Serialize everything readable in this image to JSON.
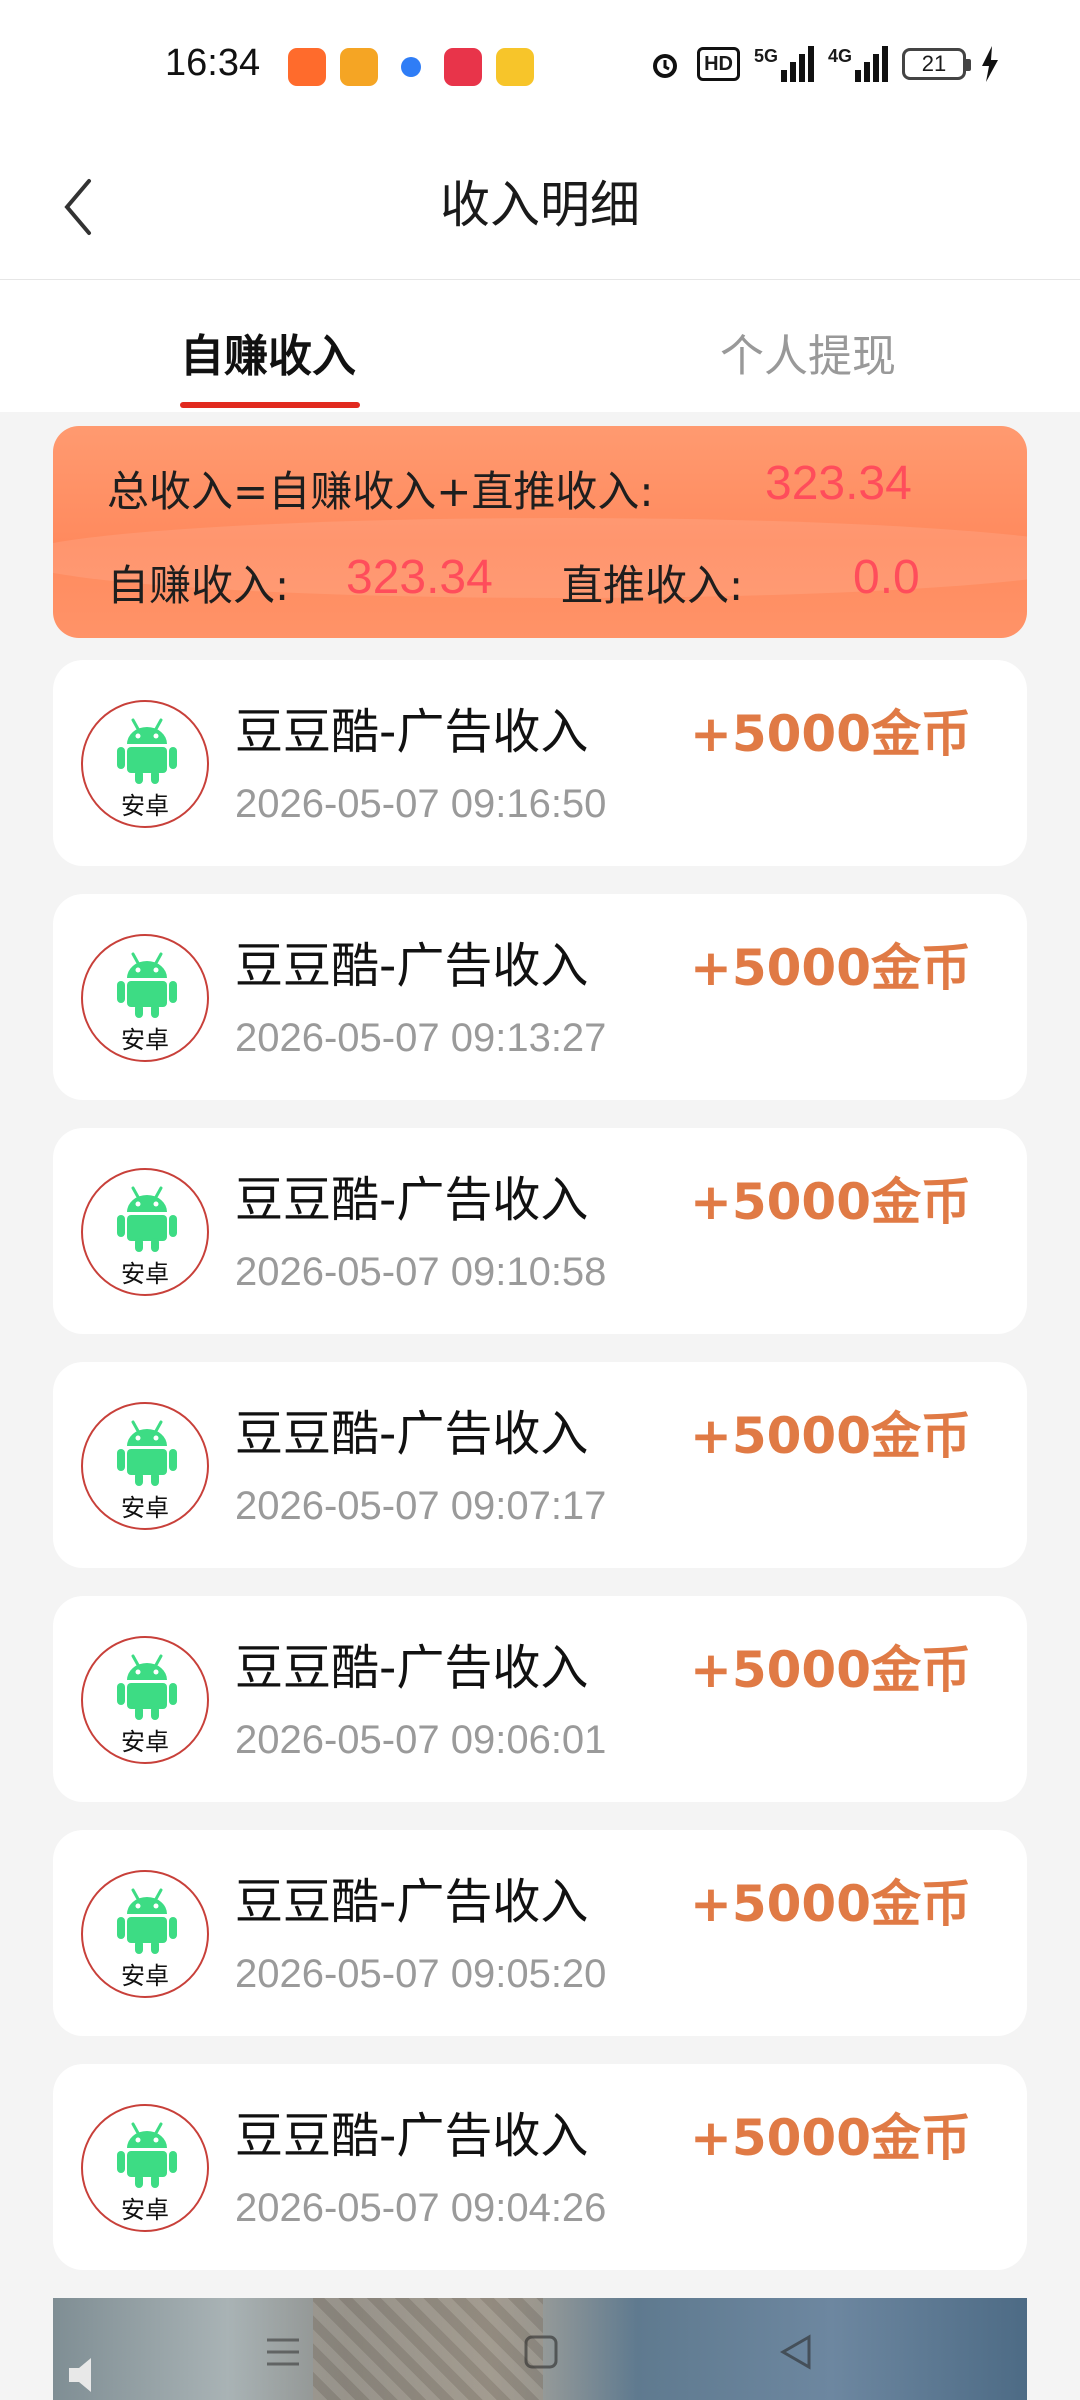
{
  "status_bar": {
    "time": "16:34",
    "hd_label": "HD",
    "net1_label": "5G",
    "net2_label": "4G",
    "battery": "21"
  },
  "header": {
    "title": "收入明细"
  },
  "tabs": [
    {
      "label": "自赚收入",
      "active": true
    },
    {
      "label": "个人提现",
      "active": false
    }
  ],
  "summary": {
    "total_label": "总收入=自赚收入+直推收入:",
    "total_value": "323.34",
    "self_label": "自赚收入:",
    "self_value": "323.34",
    "direct_label": "直推收入:",
    "direct_value": "0.0"
  },
  "items": [
    {
      "badge": "安卓",
      "title": "豆豆酷-广告收入",
      "time": "2026-05-07 09:16:50",
      "amount": "+5000金币"
    },
    {
      "badge": "安卓",
      "title": "豆豆酷-广告收入",
      "time": "2026-05-07 09:13:27",
      "amount": "+5000金币"
    },
    {
      "badge": "安卓",
      "title": "豆豆酷-广告收入",
      "time": "2026-05-07 09:10:58",
      "amount": "+5000金币"
    },
    {
      "badge": "安卓",
      "title": "豆豆酷-广告收入",
      "time": "2026-05-07 09:07:17",
      "amount": "+5000金币"
    },
    {
      "badge": "安卓",
      "title": "豆豆酷-广告收入",
      "time": "2026-05-07 09:06:01",
      "amount": "+5000金币"
    },
    {
      "badge": "安卓",
      "title": "豆豆酷-广告收入",
      "time": "2026-05-07 09:05:20",
      "amount": "+5000金币"
    },
    {
      "badge": "安卓",
      "title": "豆豆酷-广告收入",
      "time": "2026-05-07 09:04:26",
      "amount": "+5000金币"
    }
  ],
  "colors": {
    "accent_red": "#e12a1f",
    "amount_orange": "#e07a45",
    "summary_value": "#ff4d5b",
    "android_green": "#3ddc84"
  }
}
